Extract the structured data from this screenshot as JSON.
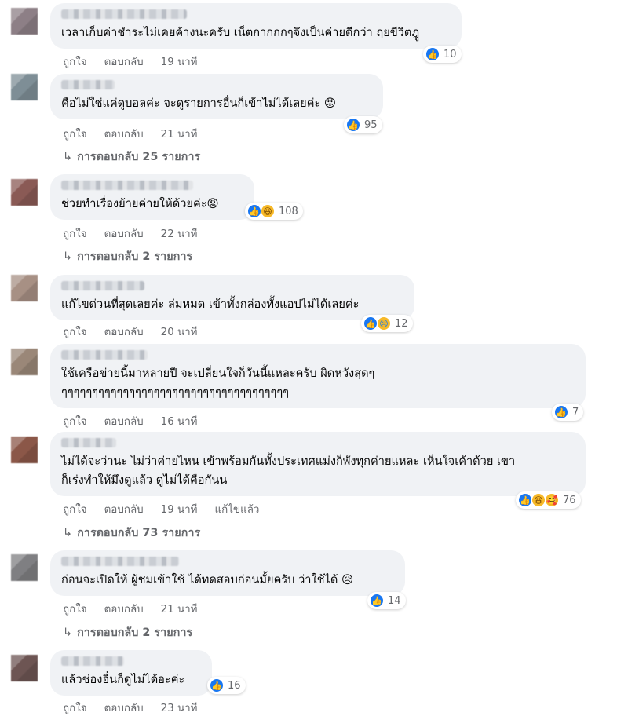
{
  "comments": [
    {
      "text": "เวลาเก็บค่าชำระไม่เคยค้างนะครับ เน็ตกากกกๆจึงเป็นค่ายดีกว่า ฤยขีวิตฎู",
      "like": "ถูกใจ",
      "reply": "ตอบกลับ",
      "time": "19 นาที",
      "reactions": [
        "like-icon"
      ],
      "count": "10"
    },
    {
      "text": "คือไม่ใช่แค่ดูบอลค่ะ จะดูรายการอื่นก็เข้าไม่ได้เลยค่ะ 😡",
      "like": "ถูกใจ",
      "reply": "ตอบกลับ",
      "time": "21 นาที",
      "reactions": [
        "like-icon"
      ],
      "count": "95",
      "replies": "การตอบกลับ 25 รายการ"
    },
    {
      "text": "ช่วยทำเรื่องย้ายค่ายให้ด้วยค่ะ😡",
      "like": "ถูกใจ",
      "reply": "ตอบกลับ",
      "time": "22 นาที",
      "reactions": [
        "like-icon",
        "haha-icon"
      ],
      "count": "108",
      "replies": "การตอบกลับ 2 รายการ"
    },
    {
      "text": "แก้ไขด่วนที่สุดเลยค่ะ ล่มหมด เข้าทั้งกล่องทั้งแอปไม่ได้เลยค่ะ",
      "like": "ถูกใจ",
      "reply": "ตอบกลับ",
      "time": "20 นาที",
      "reactions": [
        "like-icon",
        "sad-icon"
      ],
      "count": "12"
    },
    {
      "text": "ใช้เครือข่ายนี้มาหลายปี จะเปลี่ยนใจก็วันนี้แหละครับ ผิดหวังสุดๆ\nๆๆๆๆๆๆๆๆๆๆๆๆๆๆๆๆๆๆๆๆๆๆๆๆๆๆๆๆๆๆๆๆๆๆๆๆๆ",
      "like": "ถูกใจ",
      "reply": "ตอบกลับ",
      "time": "16 นาที",
      "reactions": [
        "like-icon"
      ],
      "count": "7"
    },
    {
      "text": "ไม่ได้จะว่านะ ไม่ว่าค่ายไหน เข้าพร้อมกันทั้งประเทศแม่งก็พังทุกค่ายแหละ เห็นใจเค้าด้วย เขา\nก็เร่งทำให้มึงดูแล้ว ดูไม่ได้คือกันน",
      "like": "ถูกใจ",
      "reply": "ตอบกลับ",
      "time": "19 นาที",
      "edited": "แก้ไขแล้ว",
      "reactions": [
        "like-icon",
        "haha-icon",
        "care-icon"
      ],
      "count": "76",
      "replies": "การตอบกลับ 73 รายการ"
    },
    {
      "text": "ก่อนจะเปิดให้ ผู้ชมเข้าใช้ ได้ทดสอบก่อนมั้ยครับ ว่าใช้ได้ 😥",
      "like": "ถูกใจ",
      "reply": "ตอบกลับ",
      "time": "21 นาที",
      "reactions": [
        "like-icon"
      ],
      "count": "14",
      "replies": "การตอบกลับ 2 รายการ"
    },
    {
      "text": "แล้วช่องอื่นก็ดูไม่ได้อะค่ะ",
      "like": "ถูกใจ",
      "reply": "ตอบกลับ",
      "time": "23 นาที",
      "reactions": [
        "like-icon"
      ],
      "count": "16"
    }
  ]
}
